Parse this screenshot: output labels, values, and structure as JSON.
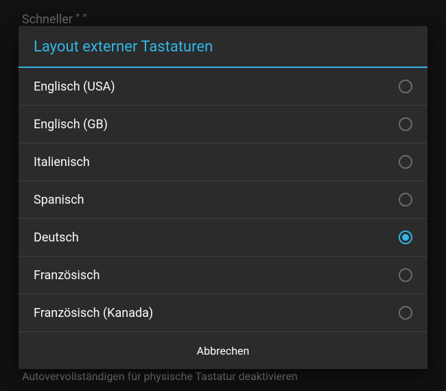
{
  "background": {
    "top_text": "Schneller \" \"",
    "bottom_text": "Autovervollständigen für physische Tastatur deaktivieren"
  },
  "dialog": {
    "title": "Layout externer Tastaturen",
    "options": [
      {
        "label": "Englisch (USA)",
        "selected": false
      },
      {
        "label": "Englisch (GB)",
        "selected": false
      },
      {
        "label": "Italienisch",
        "selected": false
      },
      {
        "label": "Spanisch",
        "selected": false
      },
      {
        "label": "Deutsch",
        "selected": true
      },
      {
        "label": "Französisch",
        "selected": false
      },
      {
        "label": "Französisch (Kanada)",
        "selected": false
      }
    ],
    "cancel_label": "Abbrechen"
  }
}
